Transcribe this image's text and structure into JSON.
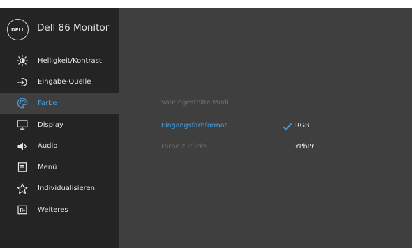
{
  "header": {
    "logo": "DELL",
    "title": "Dell 86 Monitor"
  },
  "accent_color": "#4a9fde",
  "menu": {
    "items": [
      {
        "label": "Helligkeit/Kontrast",
        "icon": "brightness-icon"
      },
      {
        "label": "Eingabe-Quelle",
        "icon": "input-source-icon"
      },
      {
        "label": "Farbe",
        "icon": "palette-icon",
        "active": true
      },
      {
        "label": "Display",
        "icon": "display-icon"
      },
      {
        "label": "Audio",
        "icon": "speaker-icon"
      },
      {
        "label": "Menü",
        "icon": "menu-icon"
      },
      {
        "label": "Individualisieren",
        "icon": "star-icon"
      },
      {
        "label": "Weiteres",
        "icon": "others-icon"
      }
    ]
  },
  "submenu": {
    "preset_modes": "Voreingestellte Modi",
    "input_color_format": "Eingangsfarbformat",
    "reset_color": "Farbe zurücks.",
    "options": {
      "rgb": "RGB",
      "ypbpr": "YPbPr"
    },
    "selected": "RGB"
  }
}
